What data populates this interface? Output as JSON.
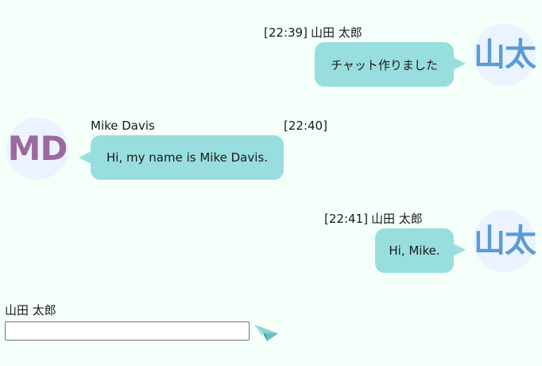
{
  "messages": [
    {
      "time": "[22:39]",
      "sender": "山田 太郎",
      "text": "チャット作りました",
      "avatar_text": "山太",
      "side": "right"
    },
    {
      "time": "[22:40]",
      "sender": "Mike Davis",
      "text": "Hi, my name is Mike Davis.",
      "avatar_text": "MD",
      "side": "left"
    },
    {
      "time": "[22:41]",
      "sender": "山田 太郎",
      "text": "Hi, Mike.",
      "avatar_text": "山太",
      "side": "right"
    }
  ],
  "compose": {
    "user_name": "山田 太郎",
    "input_value": "",
    "send_icon": "paper-plane-icon"
  },
  "colors": {
    "background": "#f4fff9",
    "bubble": "#99dede",
    "avatar_bg": "#eaf3ff",
    "avatar_jp_text": "#5b9bd5",
    "avatar_md_text": "#9a6a9f"
  }
}
